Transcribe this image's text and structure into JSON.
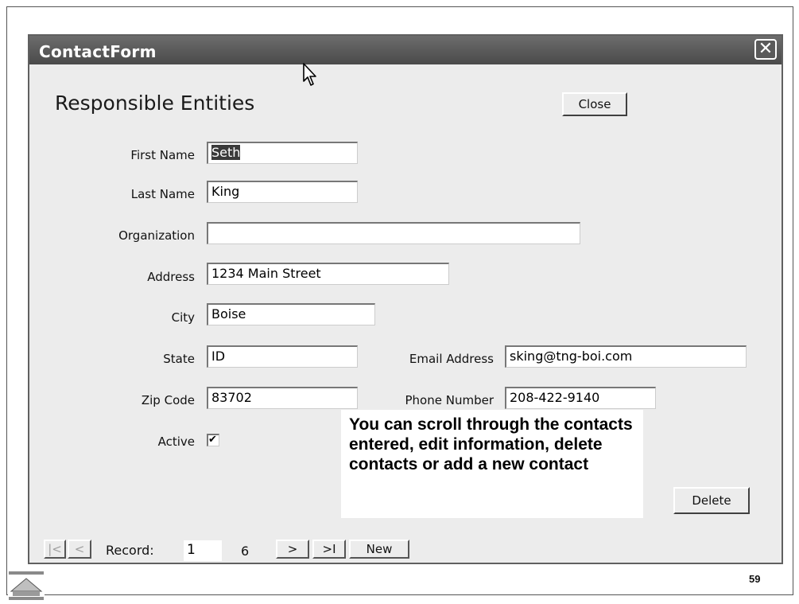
{
  "window": {
    "title": "ContactForm",
    "close_glyph": "✕"
  },
  "form": {
    "heading": "Responsible Entities",
    "close_button": "Close",
    "delete_button": "Delete",
    "fields": {
      "first_name": {
        "label": "First Name",
        "value": "Seth"
      },
      "last_name": {
        "label": "Last Name",
        "value": "King"
      },
      "organization": {
        "label": "Organization",
        "value": ""
      },
      "address": {
        "label": "Address",
        "value": "1234 Main Street"
      },
      "city": {
        "label": "City",
        "value": "Boise"
      },
      "state": {
        "label": "State",
        "value": "ID"
      },
      "email": {
        "label": "Email Address",
        "value": "sking@tng-boi.com"
      },
      "zip": {
        "label": "Zip Code",
        "value": "83702"
      },
      "phone": {
        "label": "Phone Number",
        "value": "208-422-9140"
      },
      "active": {
        "label": "Active",
        "checked": true,
        "glyph": "✔"
      }
    },
    "callout": "You can scroll through the contacts entered, edit information, delete contacts or add a new contact"
  },
  "navigation": {
    "first": "|<",
    "prev": "<",
    "record_label": "Record:",
    "record_value": "1",
    "total": "6",
    "next": ">",
    "last": ">I",
    "new": "New"
  },
  "slide": {
    "page_number": "59",
    "logo_icon": "environmental-finance-center-logo"
  }
}
